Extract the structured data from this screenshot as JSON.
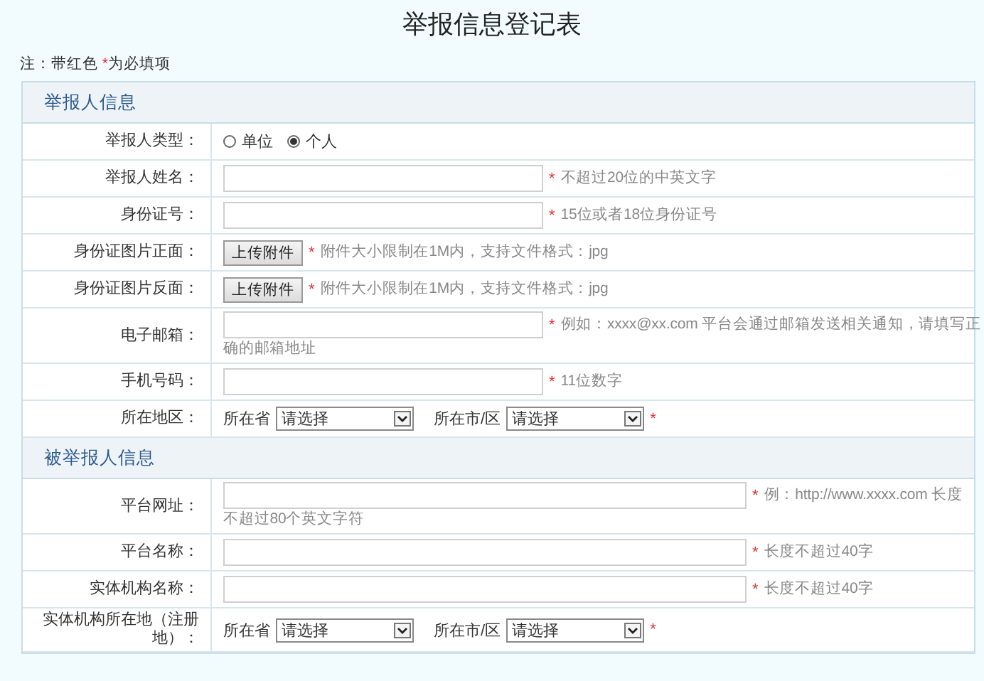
{
  "title": "举报信息登记表",
  "note": {
    "prefix": "注：带红色 ",
    "mark": "*",
    "suffix": "为必填项"
  },
  "sections": [
    {
      "heading": "举报人信息",
      "rows": [
        {
          "kind": "radio",
          "label": "举报人类型：",
          "options": [
            {
              "label": "单位",
              "selected": false
            },
            {
              "label": "个人",
              "selected": true
            }
          ]
        },
        {
          "kind": "text",
          "label": "举报人姓名：",
          "mark": "*",
          "hint": "不超过20位的中英文字"
        },
        {
          "kind": "text",
          "label": "身份证号：",
          "mark": "*",
          "hint": "15位或者18位身份证号"
        },
        {
          "kind": "upload",
          "label": "身份证图片正面：",
          "button": "上传附件",
          "mark": "*",
          "hint": "附件大小限制在1M内，支持文件格式：jpg"
        },
        {
          "kind": "upload",
          "label": "身份证图片反面：",
          "button": "上传附件",
          "mark": "*",
          "hint": "附件大小限制在1M内，支持文件格式：jpg"
        },
        {
          "kind": "text",
          "label": "电子邮箱：",
          "mark": "*",
          "hint": "例如：xxxx@xx.com 平台会通过邮箱发送相关通知，请填写正",
          "hint_wrap": "确的邮箱地址"
        },
        {
          "kind": "text",
          "label": "手机号码：",
          "mark": "*",
          "hint": "11位数字"
        },
        {
          "kind": "region",
          "label": "所在地区：",
          "province_label": "所在省",
          "province_value": "请选择",
          "city_label": "所在市/区",
          "city_value": "请选择",
          "mark": "*"
        }
      ]
    },
    {
      "heading": "被举报人信息",
      "rows": [
        {
          "kind": "wide_text",
          "label": "平台网址：",
          "mark": "*",
          "hint": "例：http://www.xxxx.com 长度",
          "hint_wrap": "不超过80个英文字符"
        },
        {
          "kind": "wide_text",
          "label": "平台名称：",
          "mark": "*",
          "hint": "长度不超过40字"
        },
        {
          "kind": "wide_text",
          "label": "实体机构名称：",
          "mark": "*",
          "hint": "长度不超过40字"
        },
        {
          "kind": "region",
          "label": "实体机构所在地（注册地）：",
          "province_label": "所在省",
          "province_value": "请选择",
          "city_label": "所在市/区",
          "city_value": "请选择",
          "mark": "*"
        }
      ]
    }
  ]
}
